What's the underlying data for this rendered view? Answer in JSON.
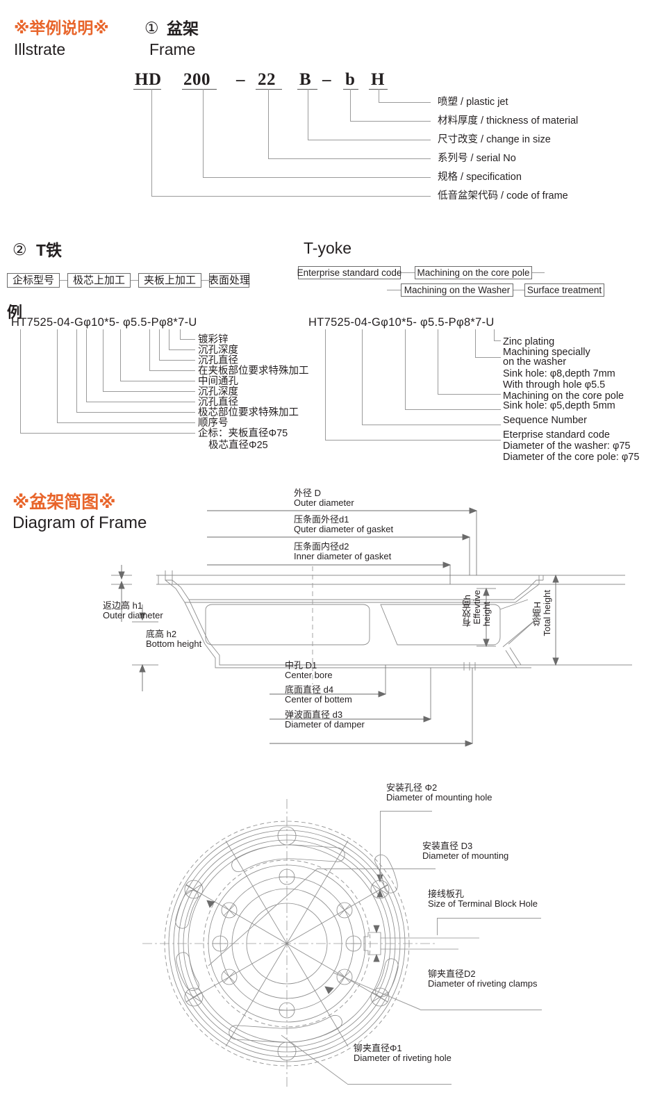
{
  "section1": {
    "illustrate_cn": "※举例说明※",
    "illustrate_en": "Illstrate",
    "item_no": "①",
    "frame_cn": "盆架",
    "frame_en": "Frame",
    "code_parts": [
      "HD",
      "200",
      "–",
      "22",
      "B",
      "–",
      "b",
      "H"
    ],
    "legend": [
      "喷塑 / plastic jet",
      "材料厚度 / thickness of material",
      "尺寸改变 / change in size",
      "系列号 / serial No",
      "规格 / specification",
      "低音盆架代码 / code of frame"
    ]
  },
  "section2": {
    "item_no": "②",
    "title_cn": "T铁",
    "title_en": "T-yoke",
    "boxes_cn": [
      "企标型号",
      "极芯上加工",
      "夹板上加工",
      "表面处理"
    ],
    "boxes_en": [
      "Enterprise standard code",
      "Machining on the core pole",
      "Machining on the Washer",
      "Surface treatment"
    ],
    "example_label": "例",
    "code_cn": "HT7525-04-Gφ10*5- φ5.5-Pφ8*7-U",
    "code_en": "HT7525-04-Gφ10*5- φ5.5-Pφ8*7-U",
    "legend_cn": [
      "镀彩锌",
      "沉孔深度",
      "沉孔直径",
      "在夹板部位要求特殊加工",
      "中间通孔",
      "沉孔深度",
      "沉孔直径",
      "极芯部位要求特殊加工",
      "顺序号",
      "企标：夹板直径Φ75",
      "极芯直径Φ25"
    ],
    "legend_en": [
      "Zinc plating",
      "Machining specially",
      "on the washer",
      "Sink hole: φ8,depth 7mm",
      "With through hole φ5.5",
      "Machining on the core pole",
      "Sink hole: φ5,depth 5mm",
      "Sequence Number",
      "Eterprise standard code",
      "Diameter of the washer: φ75",
      "Diameter of the core pole: φ75"
    ]
  },
  "section3": {
    "title_cn": "※盆架简图※",
    "title_en": "Diagram of Frame",
    "labels": [
      {
        "cn": "外径 D",
        "en": "Outer diameter"
      },
      {
        "cn": "压条面外径d1",
        "en": "Quter diameter of gasket"
      },
      {
        "cn": "压条面内径d2",
        "en": "Inner diameter of gasket"
      },
      {
        "cn": "返边高 h1",
        "en": "Outer diameter"
      },
      {
        "cn": "底高 h2",
        "en": "Bottom height"
      },
      {
        "cn": "中孔 D1",
        "en": "Center bore"
      },
      {
        "cn": "底面直径 d4",
        "en": "Center of bottem"
      },
      {
        "cn": "弹波面直径 d3",
        "en": "Diameter of damper"
      }
    ],
    "vertical_labels": [
      {
        "cn": "有效高h",
        "en1": "Effevtive",
        "en2": "height"
      },
      {
        "cn": "总高H",
        "en1": "Total height",
        "en2": ""
      }
    ]
  },
  "section4": {
    "labels": [
      {
        "cn": "安装孔径 Φ2",
        "en": "Diameter of mounting hole"
      },
      {
        "cn": "安装直径 D3",
        "en": "Diameter of mounting"
      },
      {
        "cn": "接线板孔",
        "en": "Size of Terminal Block Hole"
      },
      {
        "cn": "铆夹直径D2",
        "en": "Diameter of riveting clamps"
      },
      {
        "cn": "铆夹直径Φ1",
        "en": "Diameter of riveting hole"
      }
    ]
  },
  "colors": {
    "accent": "#E8652B",
    "text": "#231f20",
    "line": "#9a9a9a",
    "drawing": "#8c8c8c"
  }
}
